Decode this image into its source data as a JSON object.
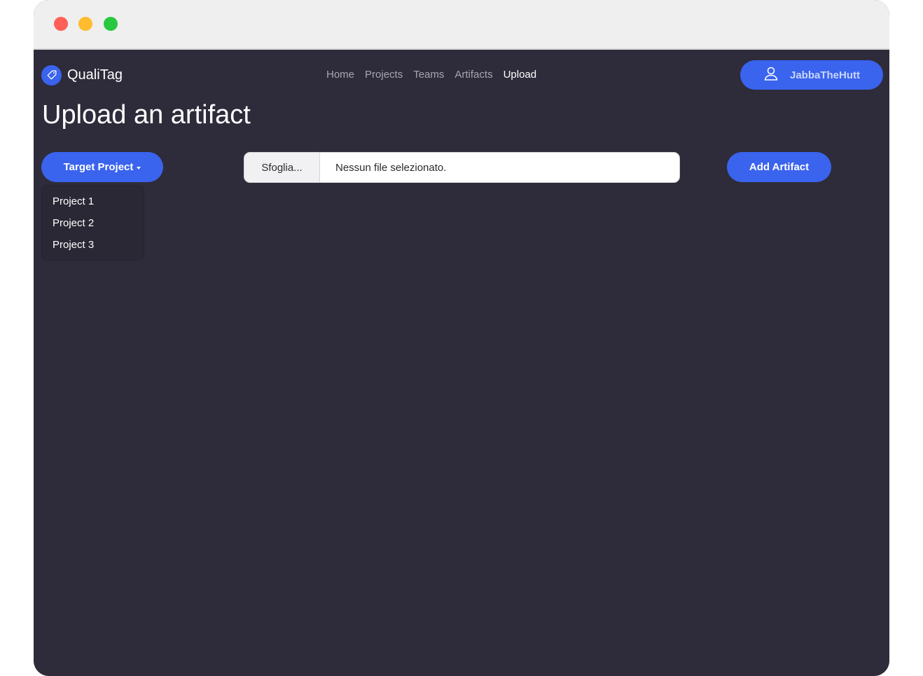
{
  "colors": {
    "accent": "#3a63ee",
    "background": "#2e2c3a",
    "titlebar": "#efefef"
  },
  "brand": {
    "name": "QualiTag",
    "icon": "tag-icon"
  },
  "nav": {
    "items": [
      "Home",
      "Projects",
      "Teams",
      "Artifacts",
      "Upload"
    ],
    "active": "Upload"
  },
  "user": {
    "name": "JabbaTheHutt",
    "icon": "user-icon"
  },
  "page": {
    "title": "Upload an artifact"
  },
  "target_project": {
    "label": "Target Project",
    "options": [
      "Project 1",
      "Project 2",
      "Project 3"
    ]
  },
  "file_input": {
    "browse_label": "Sfoglia...",
    "status": "Nessun file selezionato."
  },
  "add_artifact": {
    "label": "Add Artifact"
  }
}
